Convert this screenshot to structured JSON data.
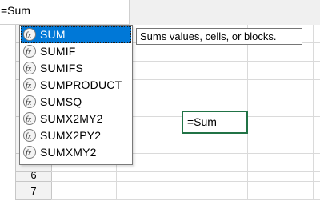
{
  "formula_bar": {
    "value": "=Sum"
  },
  "row_headers": [
    "6",
    "7"
  ],
  "active_cell": {
    "value": "=Sum"
  },
  "autocomplete": {
    "icon": "function-icon",
    "items": [
      "SUM",
      "SUMIF",
      "SUMIFS",
      "SUMPRODUCT",
      "SUMSQ",
      "SUMX2MY2",
      "SUMX2PY2",
      "SUMXMY2"
    ],
    "selected_index": 0
  },
  "tooltip": {
    "text": "Sums values, cells, or blocks."
  },
  "colors": {
    "selection": "#0078d7",
    "active_cell_border": "#217346"
  }
}
